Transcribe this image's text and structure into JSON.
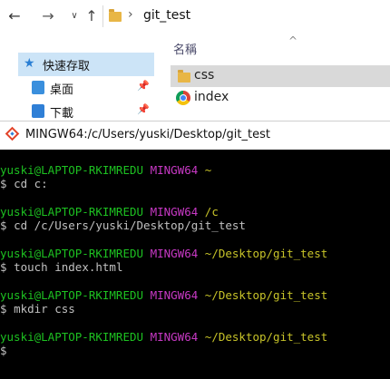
{
  "explorer": {
    "nav": {
      "back": "←",
      "forward": "→",
      "recent": "∨",
      "up": "↑"
    },
    "address_separator": "›",
    "address": "git_test",
    "column_header": "名稱",
    "sort_arrow": "^",
    "quick_access": "快速存取",
    "sidebar": [
      {
        "label": "桌面"
      },
      {
        "label": "下載"
      }
    ],
    "pin_glyph": "📌",
    "files": [
      {
        "name": "css",
        "type": "folder",
        "selected": true
      },
      {
        "name": "index",
        "type": "chrome-html",
        "selected": false
      }
    ]
  },
  "terminal": {
    "title": "MINGW64:/c/Users/yuski/Desktop/git_test",
    "user_host": "yuski@LAPTOP-RKIMREDU",
    "shell": "MINGW64",
    "sessions": [
      {
        "path": "~",
        "prompt": "$",
        "command": "cd c:"
      },
      {
        "path": "/c",
        "prompt": "$",
        "command": "cd /c/Users/yuski/Desktop/git_test"
      },
      {
        "path": "~/Desktop/git_test",
        "prompt": "$",
        "command": "touch index.html"
      },
      {
        "path": "~/Desktop/git_test",
        "prompt": "$",
        "command": "mkdir css"
      },
      {
        "path": "~/Desktop/git_test",
        "prompt": "$",
        "command": ""
      }
    ],
    "colors": {
      "background": "#000000",
      "user": "#1dc121",
      "shell": "#c839c5",
      "path": "#c7c329",
      "text": "#c0c0c0"
    }
  }
}
